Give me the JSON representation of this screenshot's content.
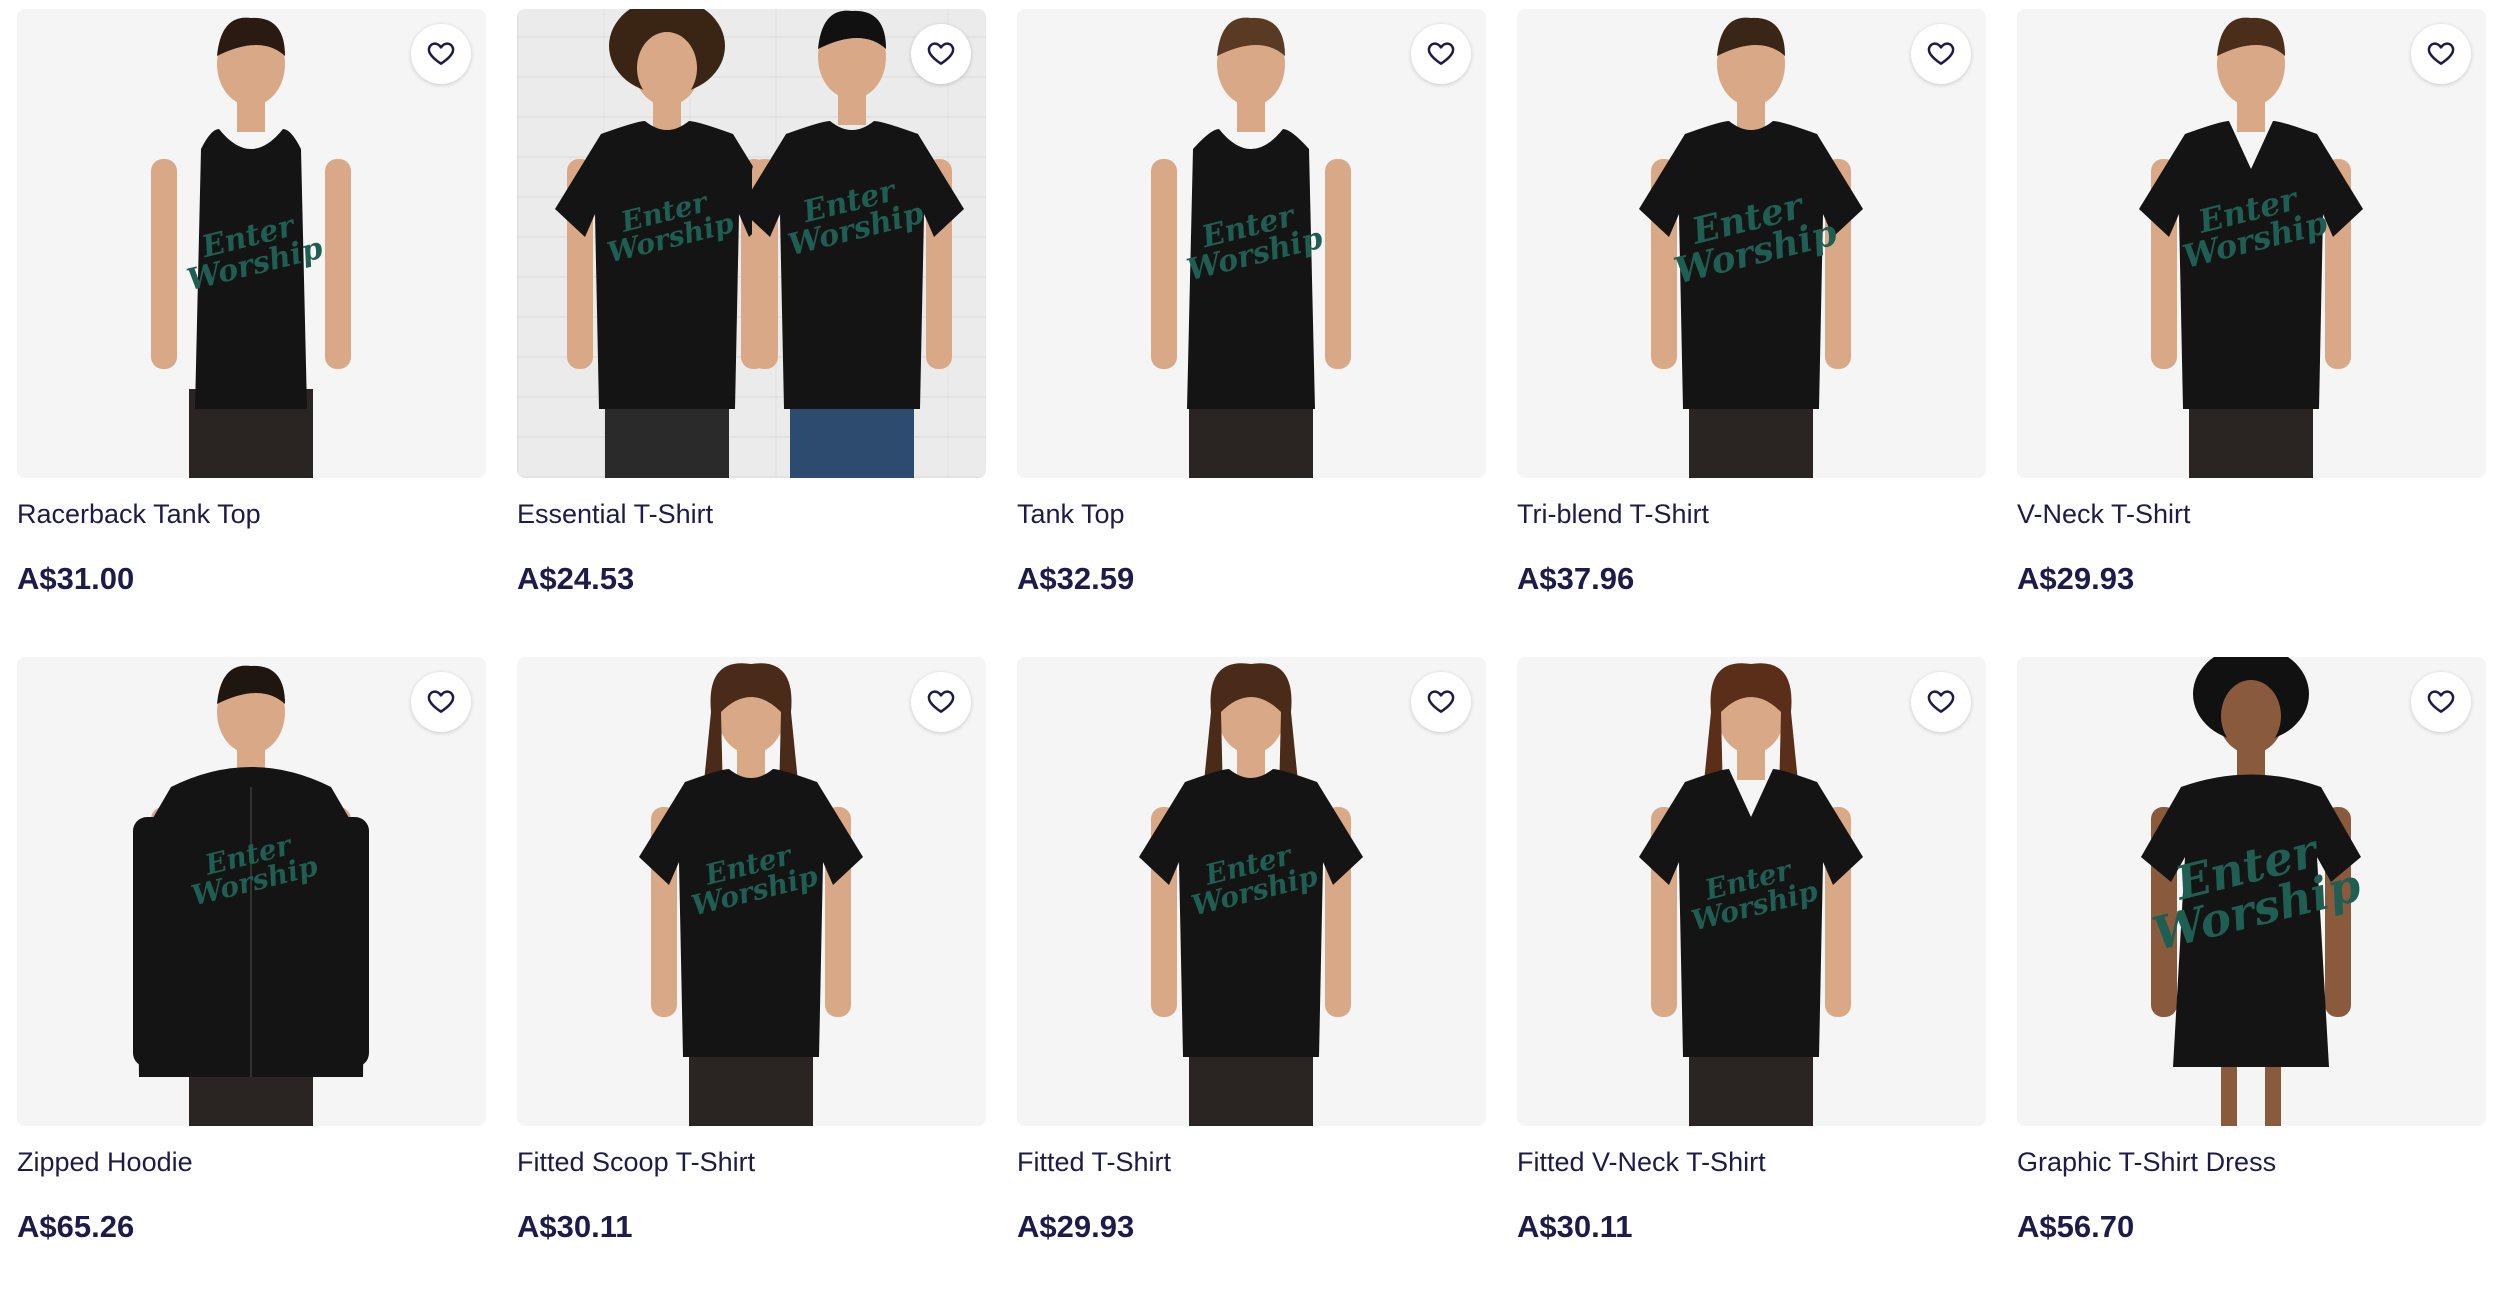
{
  "colors": {
    "text": "#1c1b4a",
    "card_bg": "#f5f5f5",
    "garment": "#141414",
    "print": "#1f5e52"
  },
  "print_text": [
    "Enter",
    "Worship"
  ],
  "products": [
    {
      "name": "Racerback Tank Top",
      "price": "A$31.00",
      "style": "racerback"
    },
    {
      "name": "Essential T-Shirt",
      "price": "A$24.53",
      "style": "duo"
    },
    {
      "name": "Tank Top",
      "price": "A$32.59",
      "style": "tank"
    },
    {
      "name": "Tri-blend T-Shirt",
      "price": "A$37.96",
      "style": "tee"
    },
    {
      "name": "V-Neck T-Shirt",
      "price": "A$29.93",
      "style": "vneck"
    },
    {
      "name": "Zipped Hoodie",
      "price": "A$65.26",
      "style": "hoodie"
    },
    {
      "name": "Fitted Scoop T-Shirt",
      "price": "A$30.11",
      "style": "fitted"
    },
    {
      "name": "Fitted T-Shirt",
      "price": "A$29.93",
      "style": "fitted"
    },
    {
      "name": "Fitted V-Neck T-Shirt",
      "price": "A$30.11",
      "style": "fittedv"
    },
    {
      "name": "Graphic T-Shirt Dress",
      "price": "A$56.70",
      "style": "dress"
    }
  ],
  "icons": {
    "favorite": "heart-outline-icon"
  }
}
